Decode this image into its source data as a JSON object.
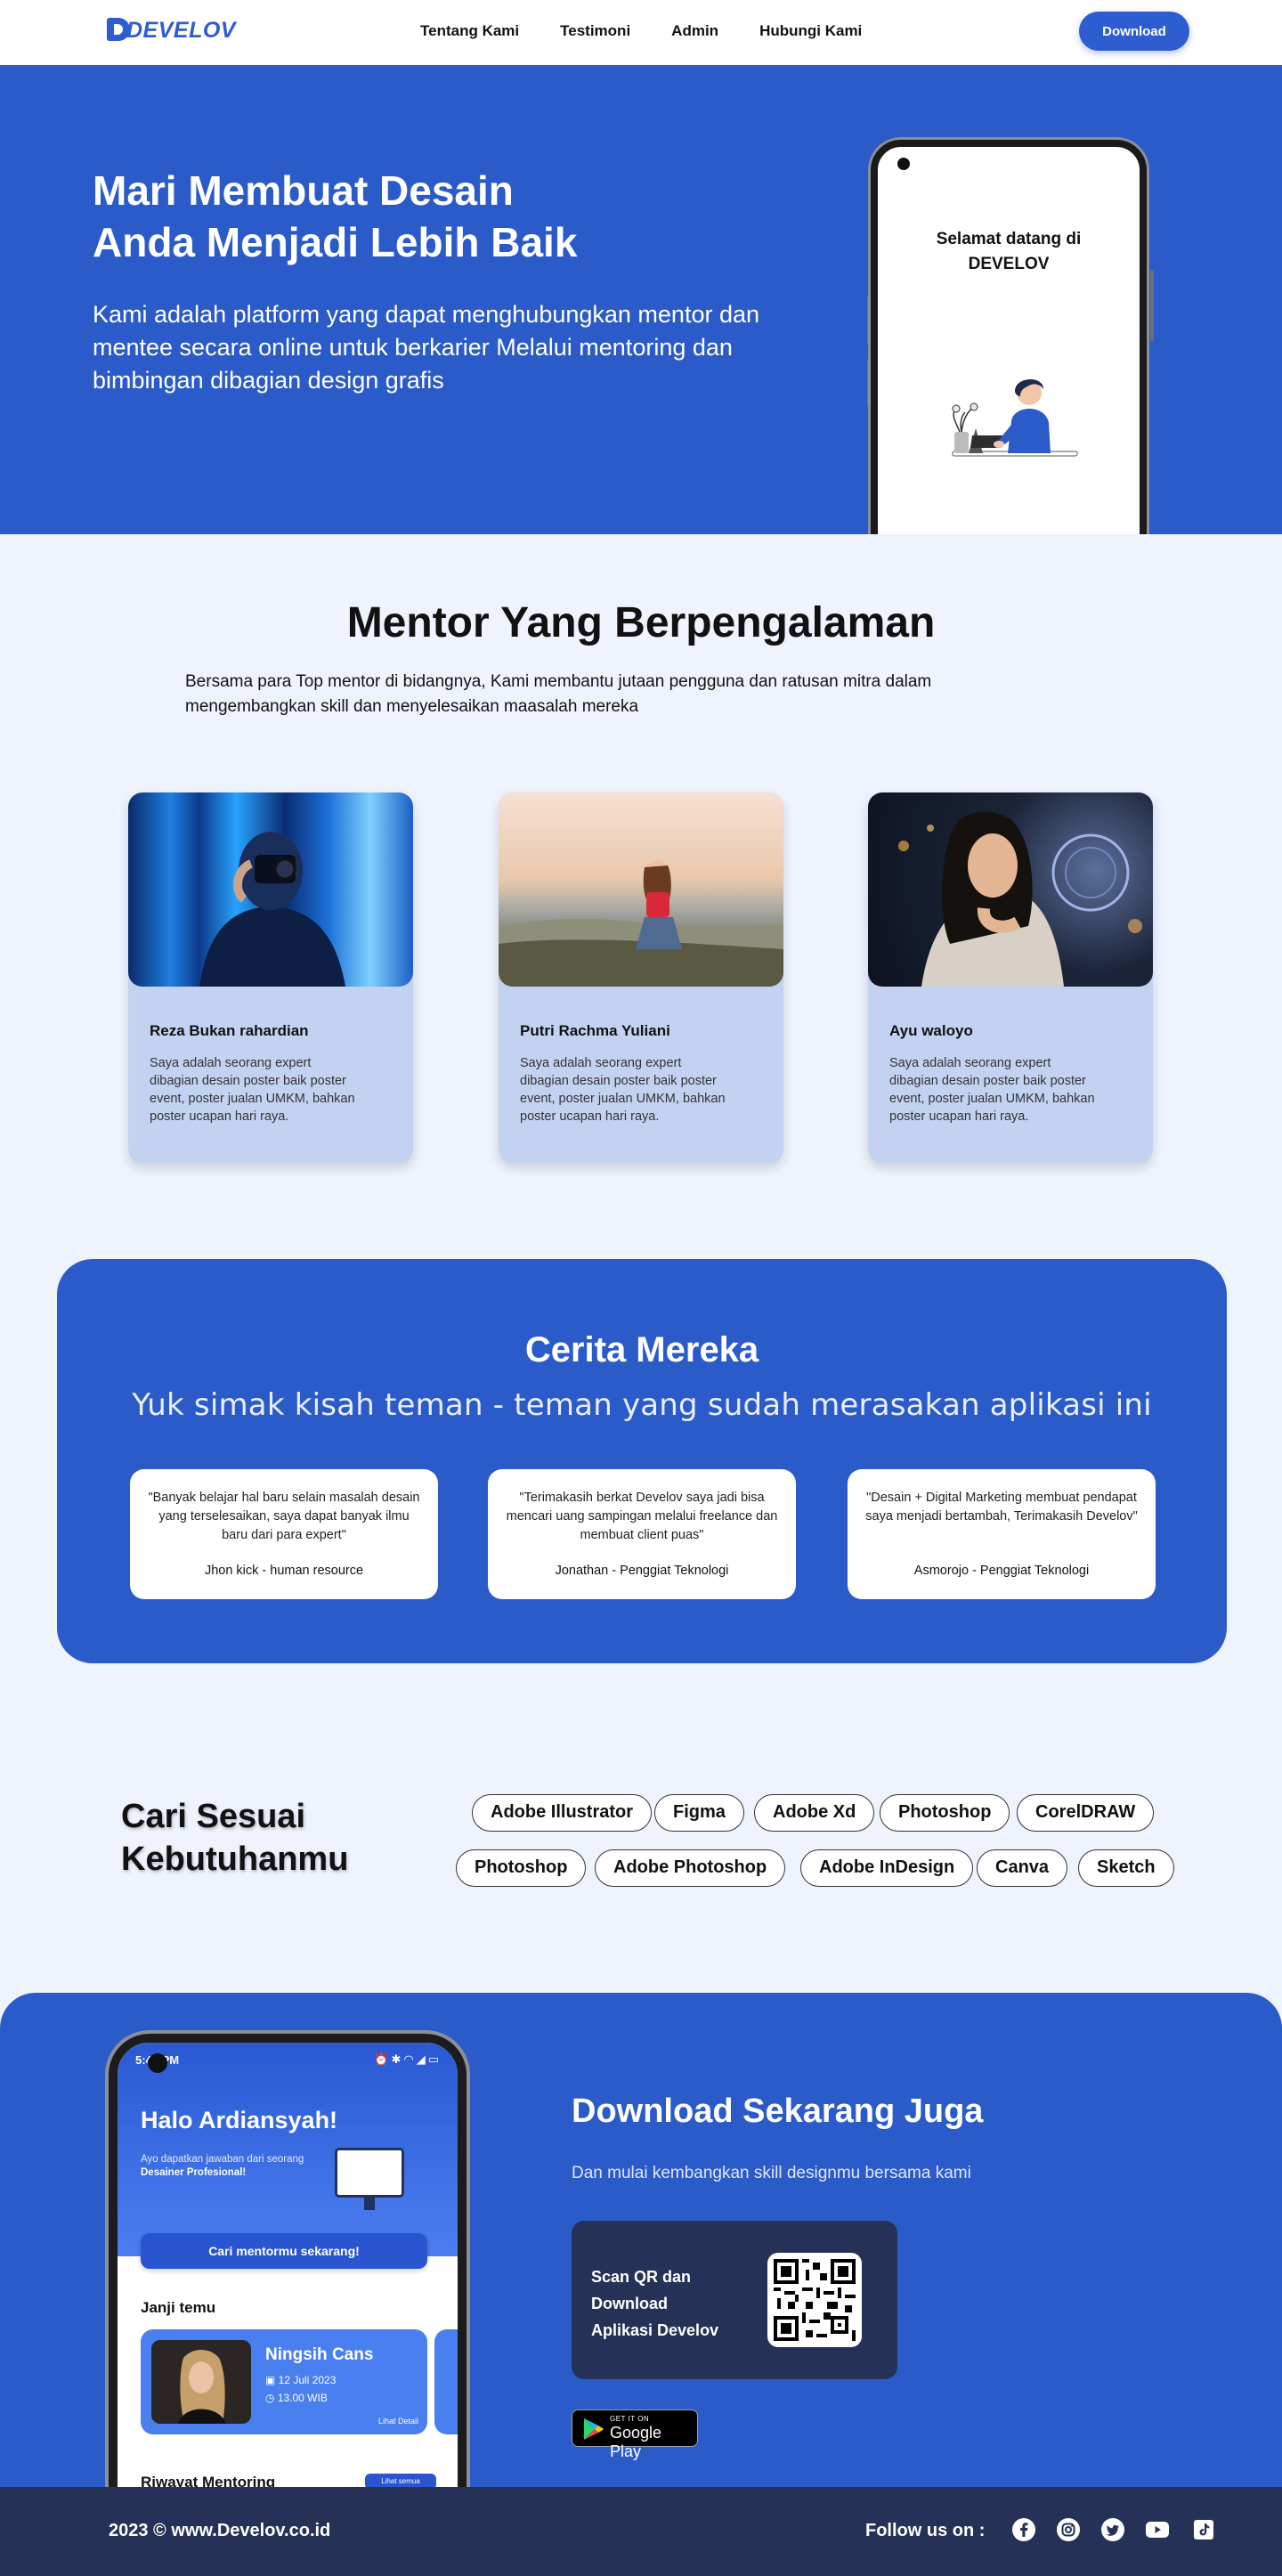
{
  "nav": {
    "logo": "DEVELOV",
    "links": [
      "Tentang Kami",
      "Testimoni",
      "Admin",
      "Hubungi Kami"
    ],
    "download_label": "Download"
  },
  "hero": {
    "title_line1": "Mari Membuat Desain",
    "title_line2": "Anda Menjadi Lebih Baik",
    "description": "Kami adalah platform yang dapat menghubungkan mentor dan mentee secara online untuk berkarier Melalui mentoring dan bimbingan dibagian design grafis",
    "phone_welcome_line1": "Selamat datang di",
    "phone_welcome_line2": "DEVELOV"
  },
  "mentors": {
    "title": "Mentor Yang Berpengalaman",
    "subtitle": "Bersama para Top mentor di bidangnya, Kami membantu jutaan pengguna dan ratusan mitra dalam mengembangkan skill dan menyelesaikan maasalah mereka",
    "items": [
      {
        "name": "Reza Bukan rahardian",
        "bio": "Saya adalah seorang expert dibagian desain poster baik poster event, poster jualan UMKM, bahkan poster ucapan hari raya."
      },
      {
        "name": "Putri Rachma Yuliani",
        "bio": "Saya adalah seorang expert dibagian desain poster baik poster event, poster jualan UMKM, bahkan poster ucapan hari raya."
      },
      {
        "name": "Ayu waloyo",
        "bio": "Saya adalah seorang expert dibagian desain poster baik poster event, poster jualan UMKM, bahkan poster ucapan hari raya."
      }
    ]
  },
  "testimonials": {
    "title": "Cerita Mereka",
    "subtitle": "Yuk simak kisah teman - teman yang sudah merasakan aplikasi ini",
    "items": [
      {
        "quote": "\"Banyak belajar hal baru selain masalah desain yang terselesaikan, saya dapat banyak ilmu baru dari para expert\"",
        "author": "Jhon kick - human resource"
      },
      {
        "quote": "\"Terimakasih berkat Develov saya jadi bisa mencari uang sampingan melalui freelance dan membuat client puas\"",
        "author": "Jonathan - Penggiat Teknologi"
      },
      {
        "quote": "\"Desain + Digital Marketing membuat pendapat saya menjadi bertambah, Terimakasih Develov\"",
        "author": "Asmorojo - Penggiat Teknologi"
      }
    ]
  },
  "tools": {
    "title_line1": "Cari Sesuai",
    "title_line2": "Kebutuhanmu",
    "chips": [
      "Adobe Illustrator",
      "Figma",
      "Adobe Xd",
      "Photoshop",
      "CorelDRAW",
      "Photoshop",
      "Adobe Photoshop",
      "Adobe InDesign",
      "Canva",
      "Sketch"
    ]
  },
  "download": {
    "title": "Download Sekarang Juga",
    "subtitle": "Dan mulai kembangkan skill designmu bersama kami",
    "qr_line1": "Scan QR dan",
    "qr_line2": "Download",
    "qr_line3": "Aplikasi Develov",
    "gplay_small": "GET IT ON",
    "gplay_big": "Google Play",
    "phone": {
      "status_time": "5:48 PM",
      "greeting": "Halo Ardiansyah!",
      "greeting_sub": "Ayo dapatkan jawaban dari seorang",
      "greeting_sub_bold": "Desainer Profesional!",
      "cta": "Cari mentormu sekarang!",
      "section_janji": "Janji temu",
      "appt_name": "Ningsih Cans",
      "appt_date": "12 Juli 2023",
      "appt_time": "13.00 WIB",
      "appt_detail": "Lihat Detail",
      "section_riwayat": "Riwayat Mentoring",
      "riwayat_btn": "Lihat semua"
    }
  },
  "footer": {
    "copyright": "2023 © www.Develov.co.id",
    "follow": "Follow us on :",
    "socials": [
      "facebook-icon",
      "instagram-icon",
      "twitter-icon",
      "youtube-icon",
      "tiktok-icon"
    ]
  },
  "colors": {
    "brand_blue": "#2b5bc9",
    "nav_button": "#2e5cd1",
    "navy": "#253156",
    "page_bg": "#eef3fe",
    "mentor_card": "#c3d2f1"
  }
}
